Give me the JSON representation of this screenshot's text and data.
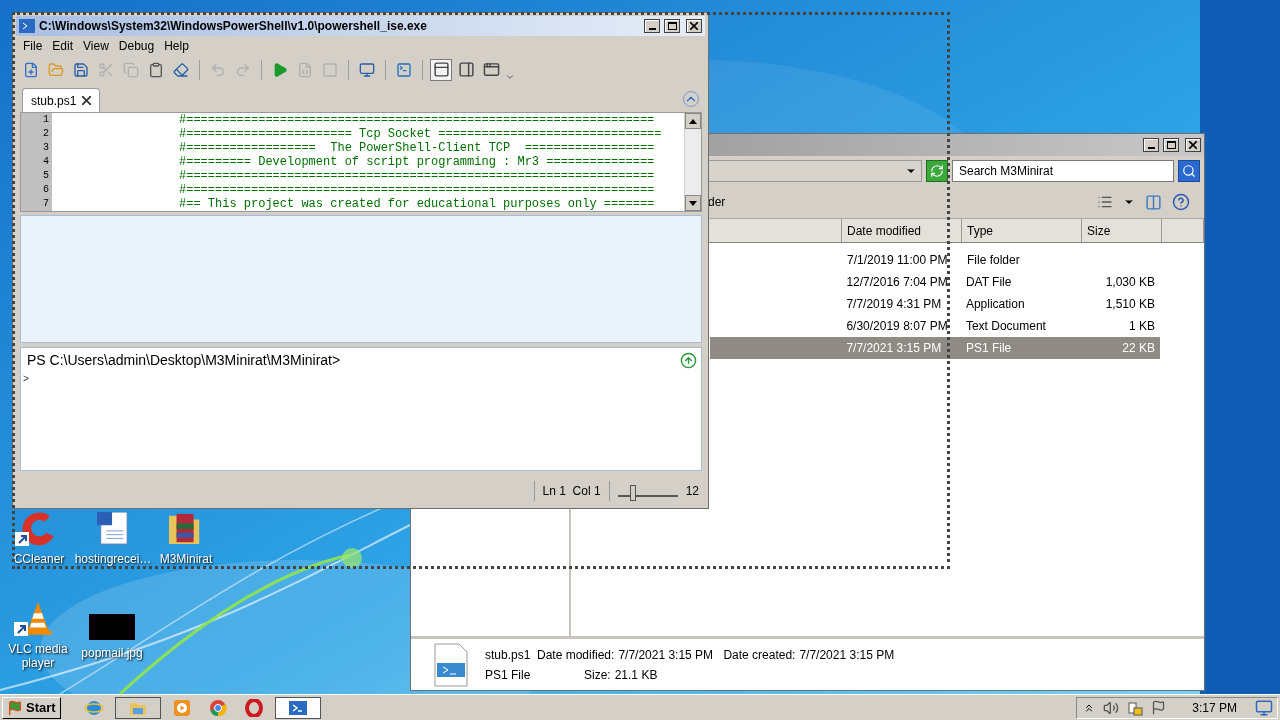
{
  "ise": {
    "title": "C:\\Windows\\System32\\WindowsPowerShell\\v1.0\\powershell_ise.exe",
    "menu": [
      "File",
      "Edit",
      "View",
      "Debug",
      "Help"
    ],
    "toolbar": [
      {
        "kind": "new",
        "disabled": false
      },
      {
        "kind": "open",
        "disabled": false
      },
      {
        "kind": "save",
        "disabled": false
      },
      {
        "kind": "cut",
        "disabled": true
      },
      {
        "kind": "copy",
        "disabled": true
      },
      {
        "kind": "paste",
        "disabled": false
      },
      {
        "kind": "clear",
        "disabled": false
      },
      {
        "kind": "undo",
        "disabled": true
      },
      {
        "kind": "redo",
        "disabled": true
      },
      {
        "kind": "run",
        "disabled": false
      },
      {
        "kind": "run-selection",
        "disabled": true
      },
      {
        "kind": "stop",
        "disabled": true
      },
      {
        "kind": "remote",
        "disabled": false
      },
      {
        "kind": "console",
        "disabled": false
      }
    ],
    "layouts": [
      {
        "kind": "top",
        "selected": true
      },
      {
        "kind": "right",
        "selected": false
      },
      {
        "kind": "max",
        "selected": false
      }
    ],
    "tabs": [
      {
        "label": "stub.ps1",
        "selected": true
      }
    ],
    "code_lines": [
      {
        "number": "1",
        "text": "#================================================================="
      },
      {
        "number": "2",
        "text": "#======================= Tcp Socket ==============================="
      },
      {
        "number": "3",
        "text": "#==================  The PowerShell-Client TCP  =================="
      },
      {
        "number": "4",
        "text": "#========= Development of script programming : Mr3 ==============="
      },
      {
        "number": "5",
        "text": "#================================================================="
      },
      {
        "number": "6",
        "text": "#================================================================="
      },
      {
        "number": "7",
        "text": "#== This project was created for educational purposes only ======="
      }
    ],
    "console": {
      "prompt": "PS C:\\Users\\admin\\Desktop\\M3Minirat\\M3Minirat>",
      "input": ">"
    },
    "status": {
      "position": "Ln 1  Col 1",
      "zoom": {
        "level": 0.25,
        "reading": "12"
      }
    }
  },
  "explorer": {
    "search": {
      "placeholder": "Search M3Minirat"
    },
    "toolbar_text": "der",
    "columns": [
      "Date modified",
      "Type",
      "Size"
    ],
    "rows": [
      {
        "date": "7/1/2019 11:00 PM",
        "type": "File folder",
        "size": "",
        "selected": false
      },
      {
        "date": "12/7/2016 7:04 PM",
        "type": "DAT File",
        "size": "1,030 KB",
        "selected": false
      },
      {
        "date": "7/7/2019 4:31 PM",
        "type": "Application",
        "size": "1,510 KB",
        "selected": false
      },
      {
        "date": "6/30/2019 8:07 PM",
        "type": "Text Document",
        "size": "1 KB",
        "selected": false
      },
      {
        "date": "7/7/2021 3:15 PM",
        "type": "PS1 File",
        "size": "22 KB",
        "selected": true
      }
    ],
    "details": {
      "name": "stub.ps1",
      "type": "PS1 File",
      "modified_label": "Date modified:",
      "modified": "7/7/2021 3:15 PM",
      "created_label": "Date created:",
      "created": "7/7/2021 3:15 PM",
      "size_label": "Size:",
      "size": "21.1 KB"
    }
  },
  "desktop_icons": [
    {
      "label": "CCleaner",
      "kind": "ccleaner",
      "shortcut": true
    },
    {
      "label": "hostingrecei…",
      "kind": "document",
      "shortcut": false
    },
    {
      "label": "M3Minirat",
      "kind": "archive",
      "shortcut": false
    },
    {
      "label": "VLC media player",
      "kind": "vlc",
      "shortcut": true
    },
    {
      "label": "popmail.jpg",
      "shortcut": false
    }
  ],
  "taskbar": {
    "start": "Start",
    "buttons": [
      {
        "kind": "ie",
        "open": false,
        "active": false
      },
      {
        "kind": "explorer",
        "open": true,
        "active": false
      },
      {
        "kind": "media",
        "open": false,
        "active": false
      },
      {
        "kind": "chrome",
        "open": false,
        "active": false
      },
      {
        "kind": "opera",
        "open": false,
        "active": false
      },
      {
        "kind": "powershell",
        "open": true,
        "active": true
      }
    ],
    "clock": "3:17 PM"
  }
}
